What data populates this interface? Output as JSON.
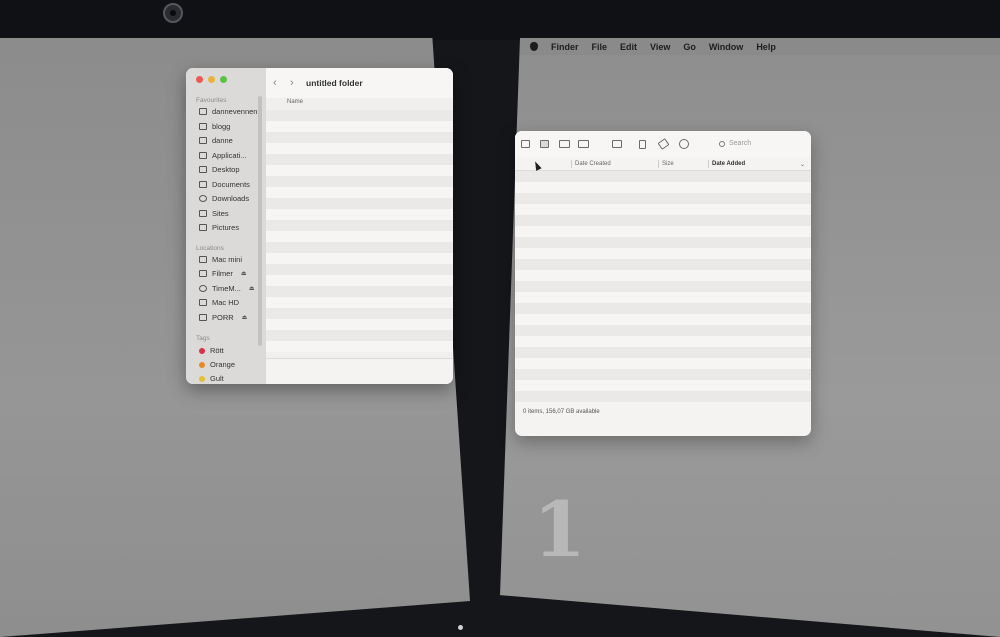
{
  "menubar": {
    "app": "Finder",
    "items": [
      "File",
      "Edit",
      "View",
      "Go",
      "Window",
      "Help"
    ]
  },
  "finder_left": {
    "title": "untitled folder",
    "column_name": "Name",
    "favourites_label": "Favourites",
    "favourites": [
      {
        "label": "dannevennen",
        "icon": "folder-icon"
      },
      {
        "label": "blogg",
        "icon": "folder-icon"
      },
      {
        "label": "danne",
        "icon": "home-icon"
      },
      {
        "label": "Applicati...",
        "icon": "applications-icon"
      },
      {
        "label": "Desktop",
        "icon": "desktop-icon"
      },
      {
        "label": "Documents",
        "icon": "document-icon"
      },
      {
        "label": "Downloads",
        "icon": "download-icon"
      },
      {
        "label": "Sites",
        "icon": "folder-icon"
      },
      {
        "label": "Pictures",
        "icon": "pictures-icon"
      }
    ],
    "locations_label": "Locations",
    "locations": [
      {
        "label": "Mac mini",
        "icon": "computer-icon"
      },
      {
        "label": "Filmer",
        "icon": "drive-icon",
        "eject": "⏏"
      },
      {
        "label": "TimeM...",
        "icon": "timemachine-icon",
        "eject": "⏏"
      },
      {
        "label": "Mac HD",
        "icon": "drive-icon"
      },
      {
        "label": "PORR",
        "icon": "drive-icon",
        "eject": "⏏"
      }
    ],
    "tags_label": "Tags",
    "tags": [
      {
        "label": "Rött",
        "color": "#d8324b"
      },
      {
        "label": "Orange",
        "color": "#e58a2a"
      },
      {
        "label": "Gult",
        "color": "#e0c232"
      }
    ]
  },
  "finder_right": {
    "search_placeholder": "Search",
    "columns": [
      "Date Created",
      "Size",
      "Date Added"
    ],
    "status": "0 items, 156,07 GB available"
  },
  "screen_number": "1"
}
